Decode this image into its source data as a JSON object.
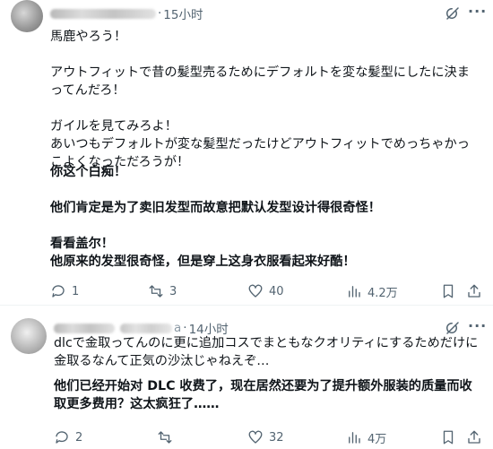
{
  "posts": [
    {
      "time": "15小时",
      "body_ja": "馬鹿やろう！\n\nアウトフィットで昔の髪型売るためにデフォルトを変な髪型にしたに決まってんだろ！\n\nガイルを見てみろよ！\nあいつもデフォルトが変な髪型だったけどアウトフィットでめっちゃかっこよくなっただろうが！",
      "body_zh": "你这个白痴！\n\n他们肯定是为了卖旧发型而故意把默认发型设计得很奇怪！\n\n看看盖尔！\n他原来的发型很奇怪，但是穿上这身衣服看起来好酷！",
      "replies": "1",
      "reposts": "3",
      "likes": "40",
      "views": "4.2万"
    },
    {
      "handle_tail": "a",
      "time": "14小时",
      "body_ja": "dlcで金取ってんのに更に追加コスでまともなクオリティにするためだけに金取るなんて正気の沙汰じゃねえぞ…",
      "body_zh": "他们已经开始对 DLC 收费了，现在居然还要为了提升额外服装的质量而收取更多费用？这太疯狂了……",
      "replies": "2",
      "reposts": "",
      "likes": "32",
      "views": "4万"
    }
  ],
  "icons": [
    "grok-icon",
    "more-icon",
    "reply-icon",
    "repost-icon",
    "like-icon",
    "views-icon",
    "bookmark-icon",
    "share-icon"
  ]
}
